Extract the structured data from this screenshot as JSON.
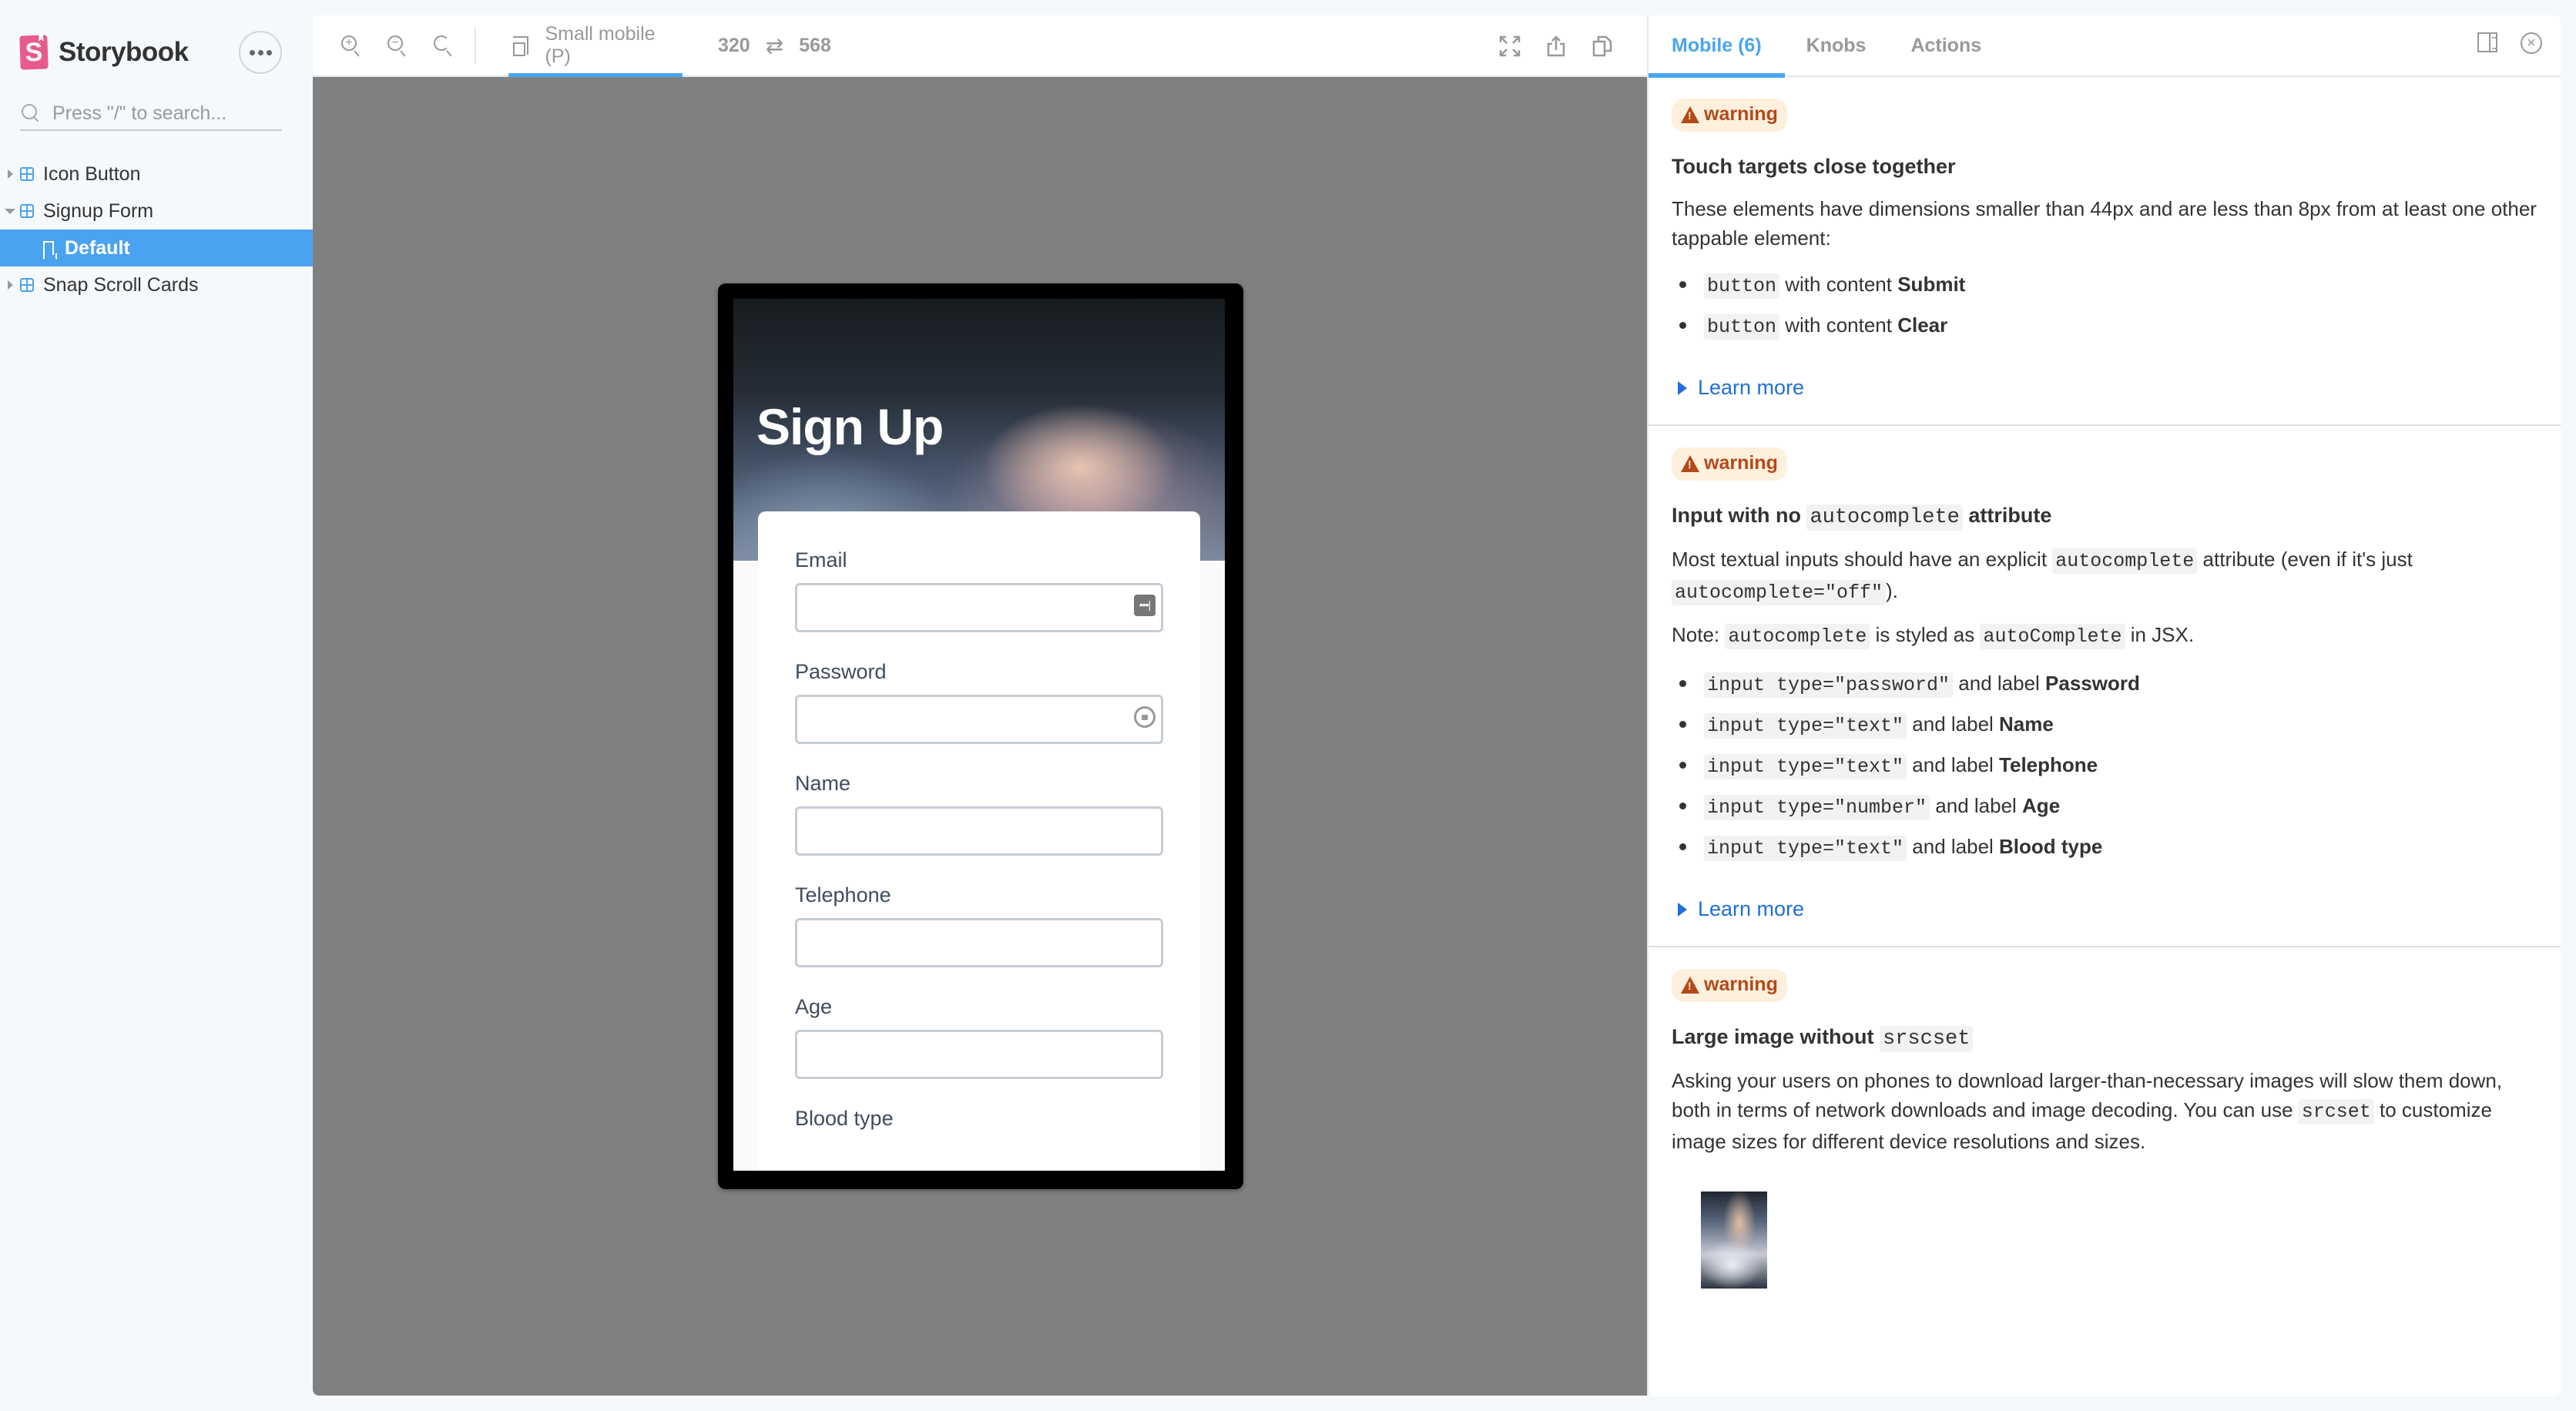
{
  "sidebar": {
    "brand": "Storybook",
    "brand_logo_letter": "S",
    "search_placeholder": "Press \"/\" to search...",
    "tree": [
      {
        "label": "Icon Button",
        "type": "component",
        "expanded": false
      },
      {
        "label": "Signup Form",
        "type": "component",
        "expanded": true
      },
      {
        "label": "Default",
        "type": "story",
        "selected": true
      },
      {
        "label": "Snap Scroll Cards",
        "type": "component",
        "expanded": false
      }
    ]
  },
  "toolbar": {
    "viewport_label": "Small mobile (P)",
    "width": "320",
    "height": "568",
    "swap_glyph": "⇄",
    "icons": [
      "zoom-in-icon",
      "zoom-out-icon",
      "zoom-reset-icon",
      "fullscreen-icon",
      "share-icon",
      "copy-icon"
    ]
  },
  "preview": {
    "title": "Sign Up",
    "password_manager_glyph": "•••|",
    "fields": [
      {
        "label": "Email",
        "value": ""
      },
      {
        "label": "Password",
        "value": ""
      },
      {
        "label": "Name",
        "value": ""
      },
      {
        "label": "Telephone",
        "value": ""
      },
      {
        "label": "Age",
        "value": ""
      }
    ],
    "cut_off_label": "Blood type"
  },
  "panel": {
    "tabs": [
      {
        "label": "Mobile (6)",
        "active": true
      },
      {
        "label": "Knobs",
        "active": false
      },
      {
        "label": "Actions",
        "active": false
      }
    ],
    "close_glyph": "×",
    "badge_label": "warning",
    "learn_more": "Learn more",
    "issues": [
      {
        "title": "Touch targets close together",
        "description": "These elements have dimensions smaller than 44px and are less than 8px from at least one other tappable element:",
        "items": [
          {
            "code": "button",
            "text": " with content ",
            "bold": "Submit"
          },
          {
            "code": "button",
            "text": " with content ",
            "bold": "Clear"
          }
        ]
      },
      {
        "title_prefix": "Input with no ",
        "title_code": "autocomplete",
        "title_suffix": " attribute",
        "desc1_a": "Most textual inputs should have an explicit ",
        "desc1_code": "autocomplete",
        "desc1_b": " attribute (even if it's just ",
        "desc1_code2": "autocomplete=\"off\"",
        "desc1_c": ").",
        "desc2_a": "Note: ",
        "desc2_code": "autocomplete",
        "desc2_b": " is styled as ",
        "desc2_code2": "autoComplete",
        "desc2_c": " in JSX.",
        "items": [
          {
            "code": "input type=\"password\"",
            "text": " and label ",
            "bold": "Password"
          },
          {
            "code": "input type=\"text\"",
            "text": " and label ",
            "bold": "Name"
          },
          {
            "code": "input type=\"text\"",
            "text": " and label ",
            "bold": "Telephone"
          },
          {
            "code": "input type=\"number\"",
            "text": " and label ",
            "bold": "Age"
          },
          {
            "code": "input type=\"text\"",
            "text": " and label ",
            "bold": "Blood type"
          }
        ]
      },
      {
        "title_prefix": "Large image without ",
        "title_code": "srscset",
        "desc_a": "Asking your users on phones to download larger-than-necessary images will slow them down, both in terms of network downloads and image decoding. You can use ",
        "desc_code": "srcset",
        "desc_b": " to customize image sizes for different device resolutions and sizes."
      }
    ]
  },
  "colors": {
    "accent": "#4aa5f0",
    "selected_row": "#4aa3f0",
    "brand": "#e85a8c",
    "warning_bg": "#fdf0dc",
    "warning_fg": "#b4491a",
    "link": "#1e6fd9",
    "canvas": "#808080"
  }
}
